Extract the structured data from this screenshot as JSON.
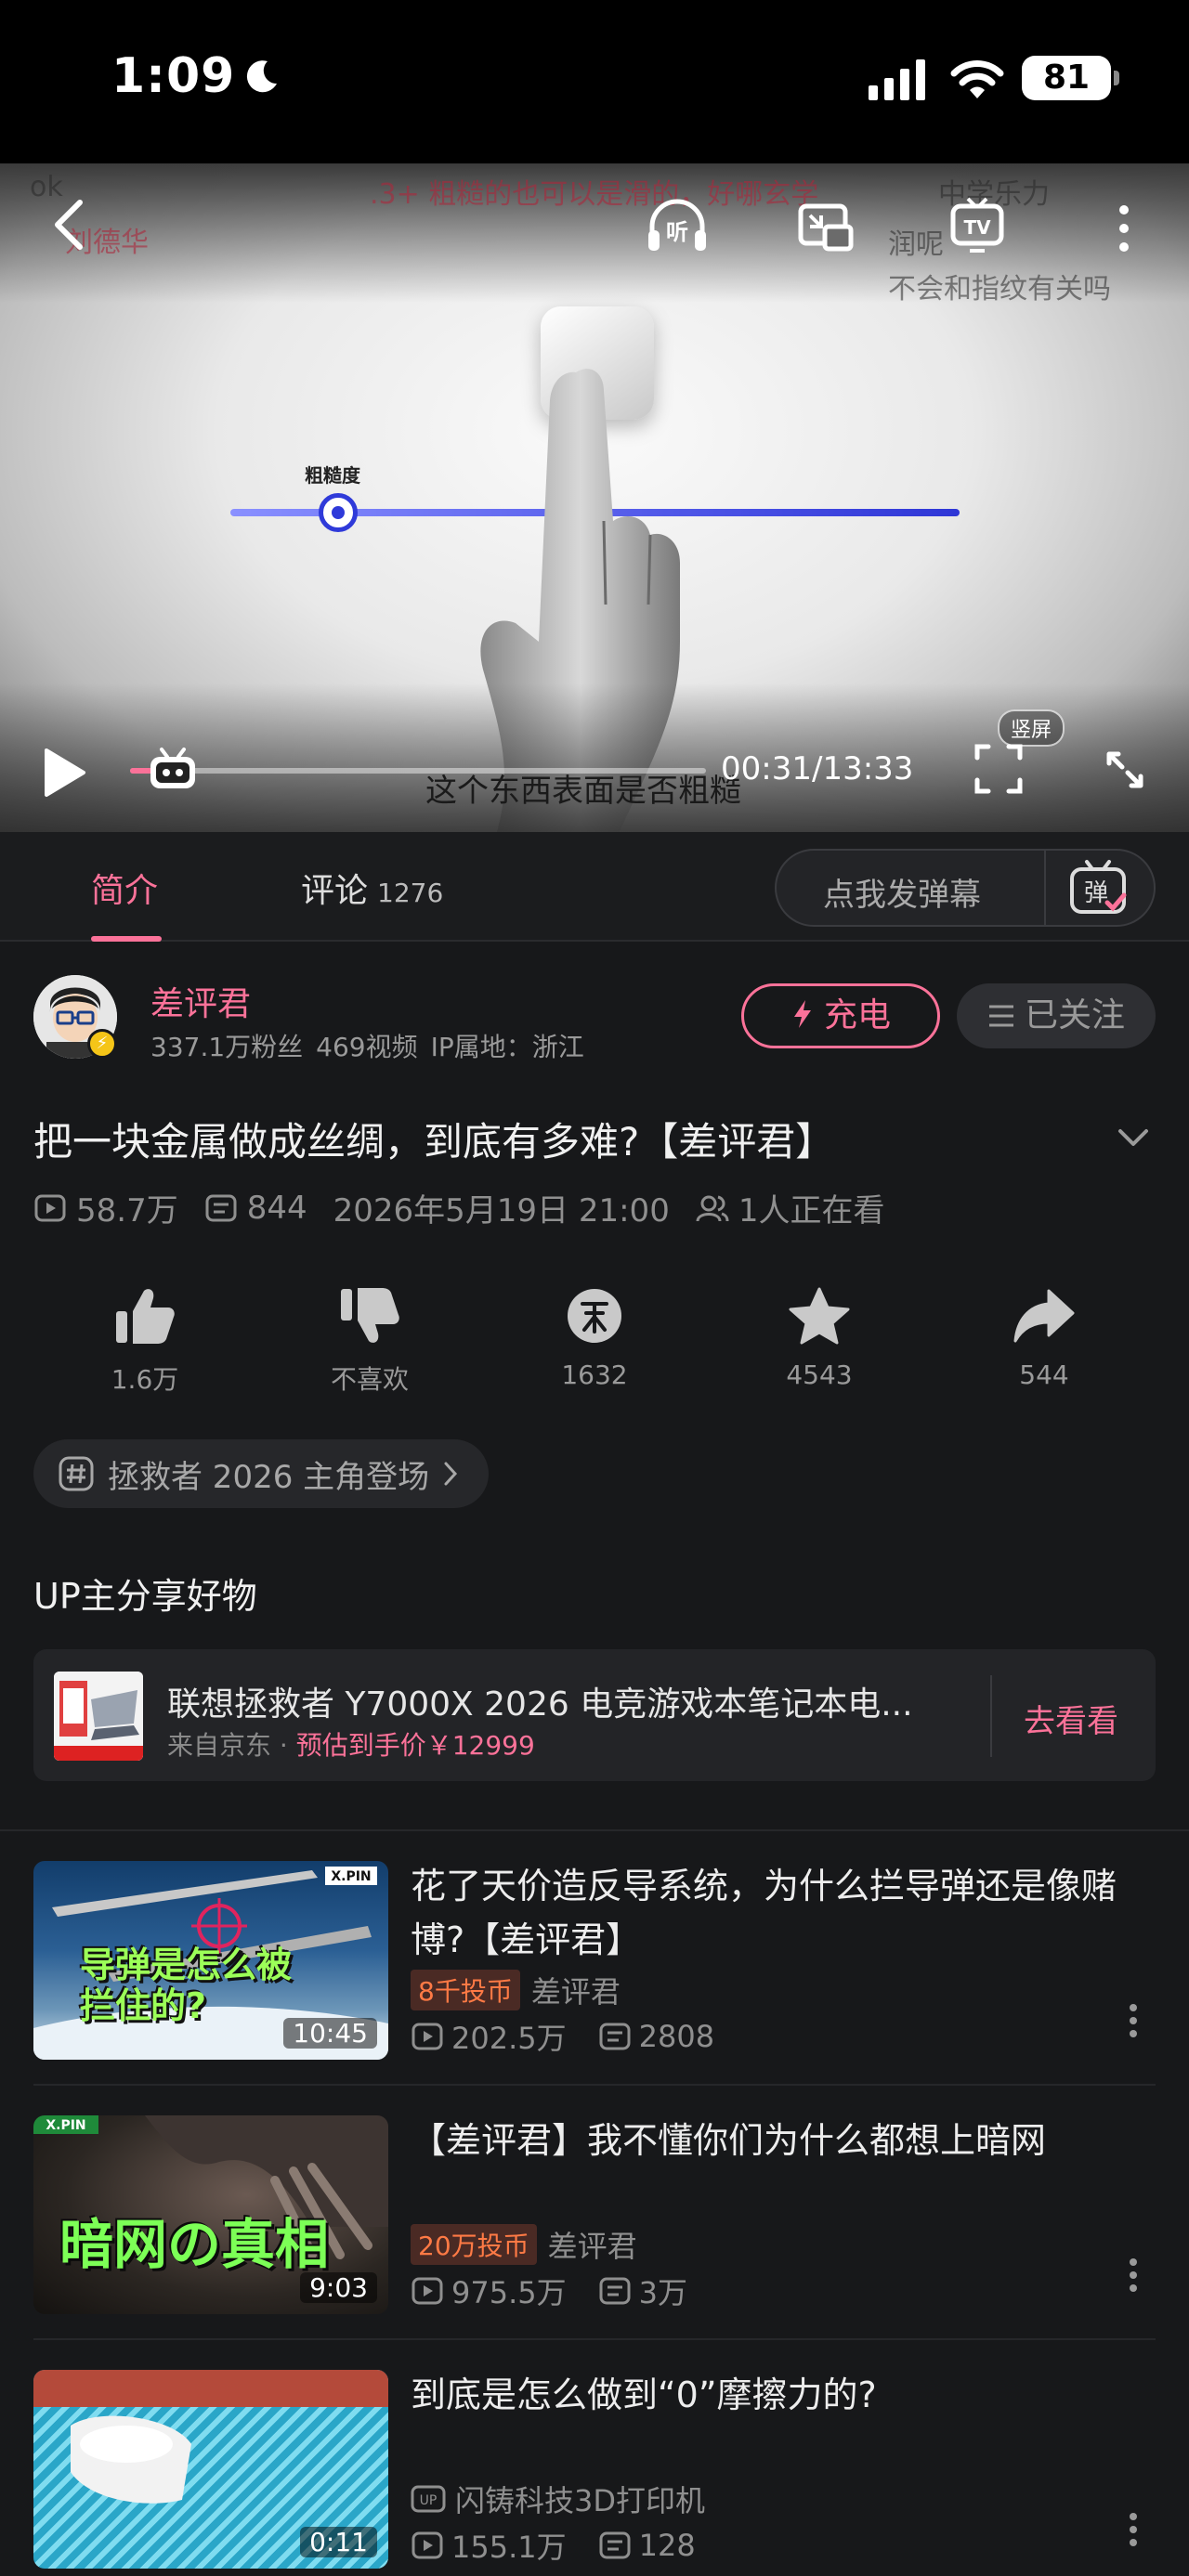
{
  "status_bar": {
    "time": "1:09",
    "battery": "81"
  },
  "player": {
    "danmaku": [
      "ok",
      "刘德华",
      ".3+ 粗糙的也可以是滑的，好哪玄学",
      "中学乐力",
      "润呢",
      "不会和指纹有关吗"
    ],
    "slider_label": "粗糙度",
    "subtitle": "这个东西表面是否粗糙",
    "time": "00:31/13:33",
    "progress": 0.039,
    "vertical_label": "竖屏"
  },
  "tabs": {
    "intro": "简介",
    "comments": "评论",
    "comment_count": "1276",
    "danmu_placeholder": "点我发弹幕"
  },
  "uploader": {
    "name": "差评君",
    "fans": "337.1万粉丝",
    "videos": "469视频",
    "ip": "IP属地：浙江",
    "charge_label": "充电",
    "follow_label": "已关注"
  },
  "video": {
    "title": "把一块金属做成丝绸，到底有多难?【差评君】",
    "views": "58.7万",
    "danmaku_count": "844",
    "publish_time": "2026年5月19日 21:00",
    "watching": "1人正在看"
  },
  "actions": {
    "like": "1.6万",
    "dislike": "不喜欢",
    "coin": "1632",
    "favorite": "4543",
    "share": "544"
  },
  "topic": "拯救者 2026 主角登场",
  "goods": {
    "heading": "UP主分享好物",
    "title": "联想拯救者 Y7000X 2026 电竞游戏本笔记本电...",
    "source": "来自京东 · ",
    "price": "预估到手价￥12999",
    "cta": "去看看"
  },
  "related": [
    {
      "title": "花了天价造反导系统，为什么拦导弹还是像赌博?【差评君】",
      "badge": "8千投币",
      "author": "差评君",
      "views": "202.5万",
      "danmaku": "2808",
      "duration": "10:45",
      "thumb_text": "导弹是怎么被拦住的?"
    },
    {
      "title": "【差评君】我不懂你们为什么都想上暗网",
      "badge": "20万投币",
      "author": "差评君",
      "views": "975.5万",
      "danmaku": "3万",
      "duration": "9:03",
      "thumb_text": "暗网の真相"
    },
    {
      "title": "到底是怎么做到“0”摩擦力的?",
      "badge": "",
      "author": "闪铸科技3D打印机",
      "views": "155.1万",
      "danmaku": "128",
      "duration": "0:11",
      "thumb_text": ""
    }
  ],
  "colors": {
    "accent": "#fb7299",
    "background": "#17181a",
    "coin_badge": "#ff7a45"
  }
}
